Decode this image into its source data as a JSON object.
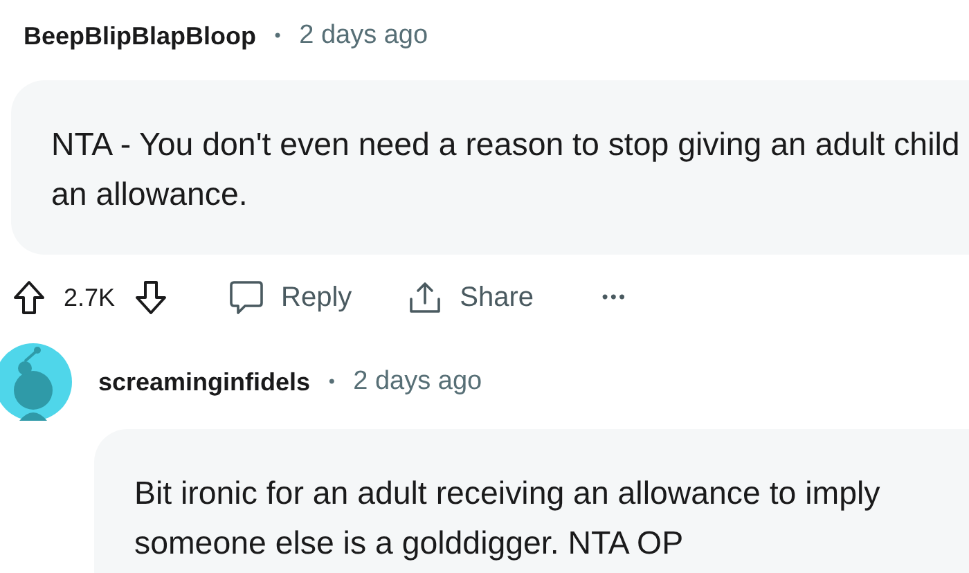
{
  "comments": [
    {
      "author": "BeepBlipBlapBloop",
      "separator": "•",
      "time": "2 days ago",
      "has_avatar": false,
      "body": "NTA - You don't even need a reason to stop giving an adult child an allowance.",
      "actions": {
        "votes": "2.7K",
        "reply": "Reply",
        "share": "Share",
        "more": "•••"
      }
    },
    {
      "author": "screaminginfidels",
      "separator": "•",
      "time": "2 days ago",
      "has_avatar": true,
      "body": "Bit ironic for an adult receiving an allowance to imply someone else is a golddigger. NTA OP"
    }
  ]
}
